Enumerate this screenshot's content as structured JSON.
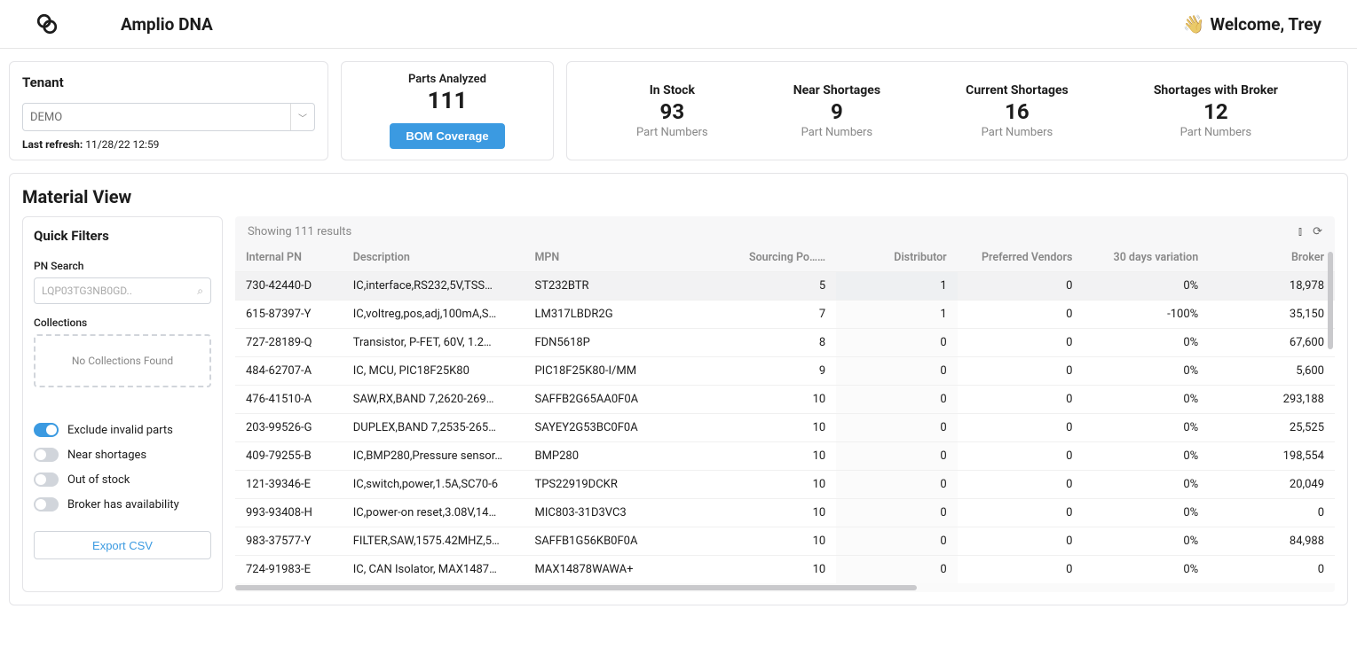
{
  "header": {
    "brand": "Amplio DNA",
    "welcome_prefix": "Welcome, ",
    "welcome_name": "Trey"
  },
  "tenant": {
    "heading": "Tenant",
    "selected": "DEMO",
    "refresh_label": "Last refresh:",
    "refresh_value": "11/28/22 12:59"
  },
  "analyzed": {
    "label": "Parts Analyzed",
    "value": "111",
    "button": "BOM Coverage"
  },
  "stats": [
    {
      "label": "In Stock",
      "value": "93",
      "sub": "Part Numbers"
    },
    {
      "label": "Near Shortages",
      "value": "9",
      "sub": "Part Numbers"
    },
    {
      "label": "Current Shortages",
      "value": "16",
      "sub": "Part Numbers"
    },
    {
      "label": "Shortages with Broker",
      "value": "12",
      "sub": "Part Numbers"
    }
  ],
  "main": {
    "title": "Material View",
    "results_text": "Showing 111 results"
  },
  "filters": {
    "heading": "Quick Filters",
    "pn_label": "PN Search",
    "pn_placeholder": "LQP03TG3NB0GD..",
    "collections_label": "Collections",
    "collections_empty": "No Collections Found",
    "toggles": [
      {
        "label": "Exclude invalid parts",
        "on": true
      },
      {
        "label": "Near shortages",
        "on": false
      },
      {
        "label": "Out of stock",
        "on": false
      },
      {
        "label": "Broker has availability",
        "on": false
      }
    ],
    "export": "Export CSV"
  },
  "columns": [
    "Internal PN",
    "Description",
    "MPN",
    "Sourcing Po…",
    "Distributor",
    "Preferred Vendors",
    "30 days variation",
    "Broker"
  ],
  "rows": [
    {
      "pn": "730-42440-D",
      "desc": "IC,interface,RS232,5V,TSS…",
      "mpn": "ST232BTR",
      "sourcing": "5",
      "dist": "1",
      "pref": "0",
      "var": "0%",
      "broker": "18,978"
    },
    {
      "pn": "615-87397-Y",
      "desc": "IC,voltreg,pos,adj,100mA,S…",
      "mpn": "LM317LBDR2G",
      "sourcing": "7",
      "dist": "1",
      "pref": "0",
      "var": "-100%",
      "broker": "35,150"
    },
    {
      "pn": "727-28189-Q",
      "desc": "Transistor, P-FET, 60V, 1.2…",
      "mpn": "FDN5618P",
      "sourcing": "8",
      "dist": "0",
      "pref": "0",
      "var": "0%",
      "broker": "67,600"
    },
    {
      "pn": "484-62707-A",
      "desc": "IC, MCU, PIC18F25K80",
      "mpn": "PIC18F25K80-I/MM",
      "sourcing": "9",
      "dist": "0",
      "pref": "0",
      "var": "0%",
      "broker": "5,600"
    },
    {
      "pn": "476-41510-A",
      "desc": "SAW,RX,BAND 7,2620-269…",
      "mpn": "SAFFB2G65AA0F0A",
      "sourcing": "10",
      "dist": "0",
      "pref": "0",
      "var": "0%",
      "broker": "293,188"
    },
    {
      "pn": "203-99526-G",
      "desc": "DUPLEX,BAND 7,2535-265…",
      "mpn": "SAYEY2G53BC0F0A",
      "sourcing": "10",
      "dist": "0",
      "pref": "0",
      "var": "0%",
      "broker": "25,525"
    },
    {
      "pn": "409-79255-B",
      "desc": "IC,BMP280,Pressure sensor…",
      "mpn": "BMP280",
      "sourcing": "10",
      "dist": "0",
      "pref": "0",
      "var": "0%",
      "broker": "198,554"
    },
    {
      "pn": "121-39346-E",
      "desc": "IC,switch,power,1.5A,SC70-6",
      "mpn": "TPS22919DCKR",
      "sourcing": "10",
      "dist": "0",
      "pref": "0",
      "var": "0%",
      "broker": "20,049"
    },
    {
      "pn": "993-93408-H",
      "desc": "IC,power-on reset,3.08V,14…",
      "mpn": "MIC803-31D3VC3",
      "sourcing": "10",
      "dist": "0",
      "pref": "0",
      "var": "0%",
      "broker": "0"
    },
    {
      "pn": "983-37577-Y",
      "desc": "FILTER,SAW,1575.42MHZ,5…",
      "mpn": "SAFFB1G56KB0F0A",
      "sourcing": "10",
      "dist": "0",
      "pref": "0",
      "var": "0%",
      "broker": "84,988"
    },
    {
      "pn": "724-91983-E",
      "desc": "IC, CAN Isolator, MAX1487…",
      "mpn": "MAX14878WAWA+",
      "sourcing": "10",
      "dist": "0",
      "pref": "0",
      "var": "0%",
      "broker": "0"
    }
  ]
}
